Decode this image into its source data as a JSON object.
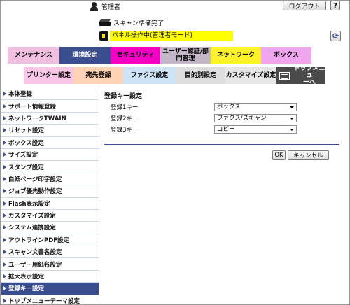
{
  "header": {
    "user_label": "管理者",
    "logout_label": "ログアウト",
    "help_label": "?",
    "status_text": "スキャン準備完了",
    "panel_status": "パネル操作中(管理者モード)",
    "refresh_label": "⟳"
  },
  "tabs": {
    "maintenance": "メンテナンス",
    "environment": "環境設定",
    "security": "セキュリティ",
    "user_auth_line1": "ユーザー認証/部",
    "user_auth_line2": "門管理",
    "network": "ネットワーク",
    "box": "ボックス",
    "colors": {
      "maintenance": "#f1c0e0",
      "environment": "#3a4d8f",
      "security": "#f300c4",
      "user_auth": "#c4b8c8",
      "network": "#fff22a",
      "box": "#f0a6ef"
    }
  },
  "subtabs": {
    "printer": "プリンター設定",
    "address": "宛先登録",
    "fax": "ファクス設定",
    "purpose": "目的別設定",
    "customize": "カスタマイズ設定",
    "top_menu_line1": "トップメニュ",
    "top_menu_line2": "ーへ",
    "colors": {
      "printer": "#f9c7e6",
      "address": "#ffd3b3",
      "fax": "#cfe3f7",
      "purpose": "#dedede",
      "customize": "#e6e6e6",
      "top_menu": "#4a4a4a"
    }
  },
  "sidebar": {
    "items": [
      {
        "label": "本体登録",
        "active": false
      },
      {
        "label": "サポート情報登録",
        "active": false
      },
      {
        "label": "ネットワークTWAIN",
        "active": false
      },
      {
        "label": "リセット設定",
        "active": false
      },
      {
        "label": "ボックス設定",
        "active": false
      },
      {
        "label": "サイズ設定",
        "active": false
      },
      {
        "label": "スタンプ設定",
        "active": false
      },
      {
        "label": "白紙ページ印字設定",
        "active": false
      },
      {
        "label": "ジョブ優先動作設定",
        "active": false
      },
      {
        "label": "Flash表示設定",
        "active": false
      },
      {
        "label": "カスタマイズ設定",
        "active": false
      },
      {
        "label": "システム連携設定",
        "active": false
      },
      {
        "label": "アウトラインPDF設定",
        "active": false
      },
      {
        "label": "スキャン文書名設定",
        "active": false
      },
      {
        "label": "ユーザー用紙名設定",
        "active": false
      },
      {
        "label": "拡大表示設定",
        "active": false
      },
      {
        "label": "登録キー設定",
        "active": true
      },
      {
        "label": "トップメニューテーマ設定",
        "active": false
      }
    ]
  },
  "main": {
    "title": "登録キー設定",
    "rows": [
      {
        "label": "登録1キー",
        "value": "ボックス"
      },
      {
        "label": "登録2キー",
        "value": "ファクス/スキャン"
      },
      {
        "label": "登録3キー",
        "value": "コピー"
      }
    ],
    "ok_label": "OK",
    "cancel_label": "キャンセル"
  }
}
